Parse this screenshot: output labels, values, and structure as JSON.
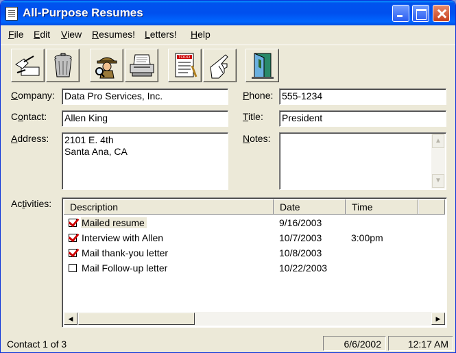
{
  "window": {
    "title": "All-Purpose Resumes"
  },
  "menu": [
    {
      "key": "F",
      "rest": "ile"
    },
    {
      "key": "E",
      "rest": "dit"
    },
    {
      "key": "V",
      "rest": "iew"
    },
    {
      "key": "R",
      "rest": "esumes!"
    },
    {
      "key": "L",
      "rest": "etters!"
    },
    {
      "key": "H",
      "rest": "elp"
    }
  ],
  "toolbar": {
    "buttons": [
      "new-record-icon",
      "trash-icon",
      "detective-icon",
      "printer-icon",
      "todo-list-icon",
      "pointing-hand-icon",
      "exit-door-icon"
    ]
  },
  "form": {
    "company": {
      "key": "C",
      "rest": "ompany:",
      "value": "Data Pro Services, Inc."
    },
    "contact": {
      "pre": "C",
      "key": "o",
      "rest": "ntact:",
      "value": "Allen King"
    },
    "address": {
      "key": "A",
      "rest": "ddress:",
      "value": "2101 E. 4th\nSanta Ana, CA"
    },
    "phone": {
      "key": "P",
      "rest": "hone:",
      "value": "555-1234"
    },
    "title": {
      "key": "T",
      "rest": "itle:",
      "value": "President"
    },
    "notes": {
      "key": "N",
      "rest": "otes:",
      "value": ""
    }
  },
  "activities": {
    "label_pre": "Ac",
    "label_key": "t",
    "label_rest": "ivities:",
    "columns": [
      "Description",
      "Date",
      "Time"
    ],
    "rows": [
      {
        "checked": true,
        "description": "Mailed resume",
        "date": "9/16/2003",
        "time": ""
      },
      {
        "checked": true,
        "description": "Interview with Allen",
        "date": "10/7/2003",
        "time": "3:00pm"
      },
      {
        "checked": true,
        "description": "Mail thank-you letter",
        "date": "10/8/2003",
        "time": ""
      },
      {
        "checked": false,
        "description": "Mail Follow-up letter",
        "date": "10/22/2003",
        "time": ""
      }
    ]
  },
  "status": {
    "record": "Contact 1 of 3",
    "date": "6/6/2002",
    "time": "12:17 AM"
  }
}
